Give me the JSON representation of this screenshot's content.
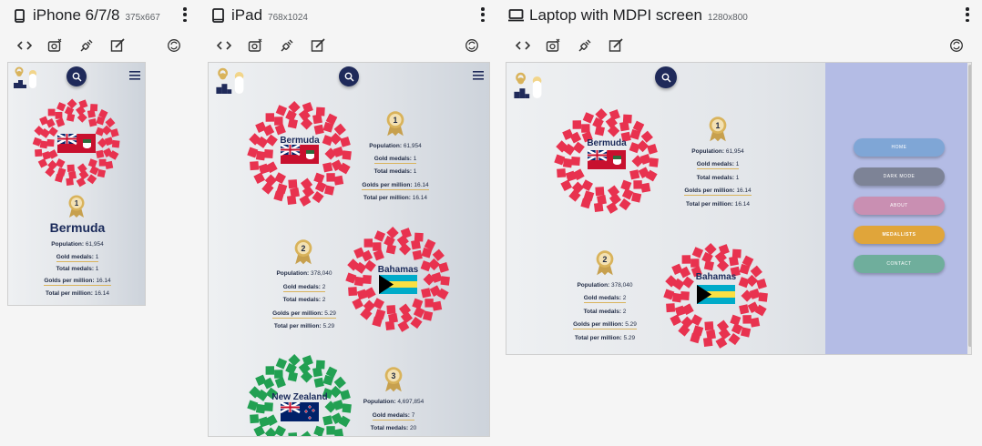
{
  "devices": [
    {
      "name": "iPhone 6/7/8",
      "resolution": "375x667"
    },
    {
      "name": "iPad",
      "resolution": "768x1024"
    },
    {
      "name": "Laptop with MDPI screen",
      "resolution": "1280x800"
    }
  ],
  "tools": {
    "code": "code-icon",
    "screenshot": "camera-icon",
    "network": "plug-icon",
    "edit": "edit-icon",
    "rotate": "rotate-icon"
  },
  "medallists": [
    {
      "rank": "1",
      "country": "Bermuda",
      "population_label": "Population:",
      "population": "61,954",
      "gold_label": "Gold medals:",
      "gold": "1",
      "total_label": "Total medals:",
      "total": "1",
      "gpm_label": "Golds per million:",
      "gpm": "16.14",
      "tpm_label": "Total per million:",
      "tpm": "16.14"
    },
    {
      "rank": "2",
      "country": "Bahamas",
      "population_label": "Population:",
      "population": "378,040",
      "gold_label": "Gold medals:",
      "gold": "2",
      "total_label": "Total medals:",
      "total": "2",
      "gpm_label": "Golds per million:",
      "gpm": "5.29",
      "tpm_label": "Total per million:",
      "tpm": "5.29"
    },
    {
      "rank": "3",
      "country": "New Zealand",
      "population_label": "Population:",
      "population": "4,697,854",
      "gold_label": "Gold medals:",
      "gold": "7",
      "total_label": "Total medals:",
      "total": "20"
    }
  ],
  "menu": {
    "home": "HOME",
    "dark_mode": "DARK MODE",
    "about": "ABOUT",
    "medallists": "MEDALLISTS",
    "contact": "CONTACT"
  },
  "colors": {
    "wreath_red": "#e8324f",
    "wreath_green": "#22a052",
    "gold": "#d9b35b",
    "navy": "#1f2a5a",
    "menu_panel": "#b4bce5"
  }
}
